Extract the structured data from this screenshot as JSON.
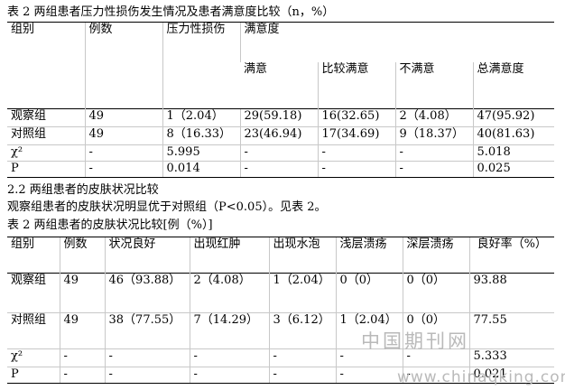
{
  "table1": {
    "caption": "表 2 两组患者压力性损伤发生情况及患者满意度比较（n，%）",
    "headers": {
      "group": "组别",
      "count": "例数",
      "pressure": "压力性损伤",
      "satisfaction": "满意度",
      "sub": [
        "满意",
        "比较满意",
        "不满意",
        "总满意度"
      ]
    },
    "rows": [
      [
        "观察组",
        "49",
        "1（2.04）",
        "29(59.18)",
        "16(32.65)",
        "2（4.08）",
        "47(95.92)"
      ],
      [
        "对照组",
        "49",
        "8（16.33）",
        "23(46.94)",
        "17(34.69)",
        "9（18.37）",
        "40(81.63)"
      ],
      [
        "χ²",
        "-",
        "5.995",
        "-",
        "-",
        "-",
        "5.018"
      ],
      [
        "P",
        "-",
        "0.014",
        "-",
        "-",
        "-",
        "0.025"
      ]
    ]
  },
  "section": {
    "heading": "2.2 两组患者的皮肤状况比较",
    "text": "观察组患者的皮肤状况明显优于对照组（P<0.05）。见表 2。"
  },
  "table2": {
    "caption": "表 2 两组患者的皮肤状况比较[例（%）]",
    "headers": [
      "组别",
      "例数",
      "状况良好",
      "出现红肿",
      "出现水泡",
      "浅层溃疡",
      "深层溃疡",
      "良好率（%）"
    ],
    "rows": [
      [
        "观察组",
        "49",
        "46（93.88）",
        "2（4.08）",
        "1（2.04）",
        "0（0）",
        "0（0）",
        "93.88"
      ],
      [
        "对照组",
        "49",
        "38（77.55）",
        "7（14.29）",
        "3（6.12）",
        "1（2.04）",
        "0（0）",
        "77.55"
      ],
      [
        "χ²",
        "-",
        "-",
        "-",
        "-",
        "-",
        "-",
        "5.333"
      ],
      [
        "P",
        "-",
        "-",
        "-",
        "-",
        "-",
        "-",
        "0.021"
      ]
    ]
  },
  "watermark": {
    "cn": "中国期刊网",
    "url": "www.chinaqking.com"
  }
}
